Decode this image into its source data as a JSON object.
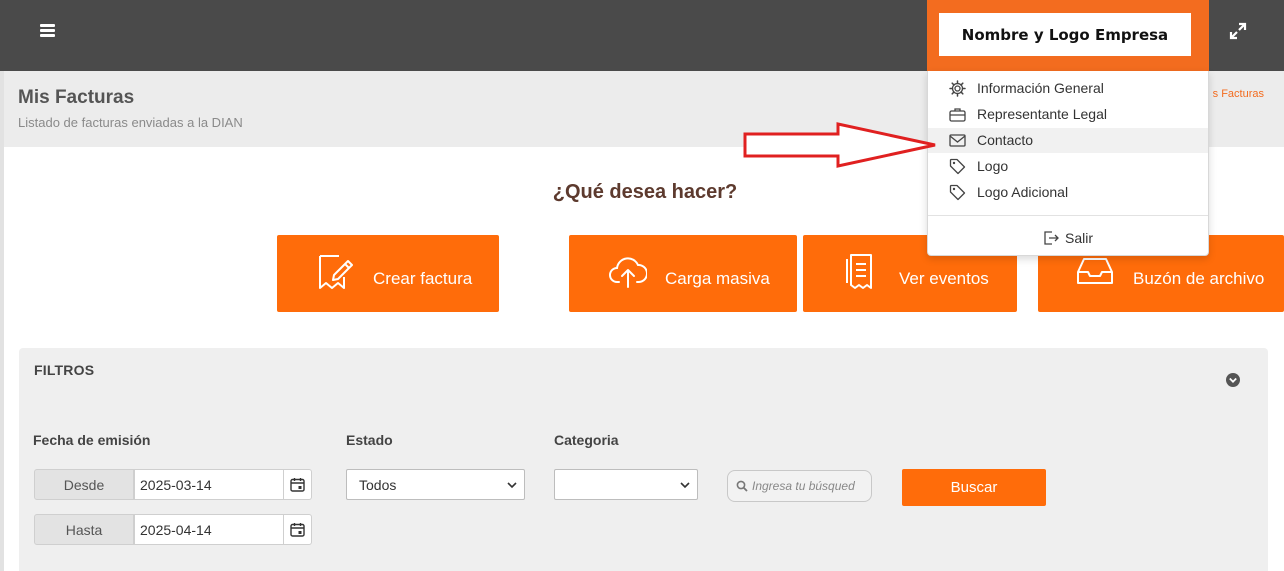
{
  "topbar": {
    "menu_icon": "hamburger-icon",
    "fullscreen_icon": "expand-icon",
    "bg_color": "#4a4a4a"
  },
  "company": {
    "logo_text": "Nombre y Logo Empresa",
    "accent": "#f36c1f"
  },
  "page": {
    "title": "Mis Facturas",
    "subtitle": "Listado de facturas enviadas a la DIAN",
    "breadcrumb": "s Facturas"
  },
  "actions": {
    "question": "¿Qué desea hacer?",
    "buttons": [
      {
        "label": "Crear factura",
        "icon": "edit-document-icon"
      },
      {
        "label": "Carga masiva",
        "icon": "cloud-upload-icon"
      },
      {
        "label": "Ver eventos",
        "icon": "receipt-icon"
      },
      {
        "label": "Buzón de archivo",
        "icon": "inbox-icon"
      }
    ],
    "color": "#ff6c0a"
  },
  "filters": {
    "title": "FILTROS",
    "date_label": "Fecha de emisión",
    "from_label": "Desde",
    "from_value": "2025-03-14",
    "to_label": "Hasta",
    "to_value": "2025-04-14",
    "status_label": "Estado",
    "status_value": "Todos",
    "category_label": "Categoria",
    "category_value": "",
    "search_placeholder": "Ingresa tu búsqued",
    "search_button": "Buscar"
  },
  "user_menu": {
    "items": [
      {
        "label": "Información General",
        "icon": "gear-icon"
      },
      {
        "label": "Representante Legal",
        "icon": "briefcase-icon"
      },
      {
        "label": "Contacto",
        "icon": "envelope-icon"
      },
      {
        "label": "Logo",
        "icon": "tag-icon"
      },
      {
        "label": "Logo Adicional",
        "icon": "tag-icon"
      }
    ],
    "logout_label": "Salir",
    "highlighted_index": 2
  },
  "annotation": {
    "arrow_color": "#e02020"
  }
}
